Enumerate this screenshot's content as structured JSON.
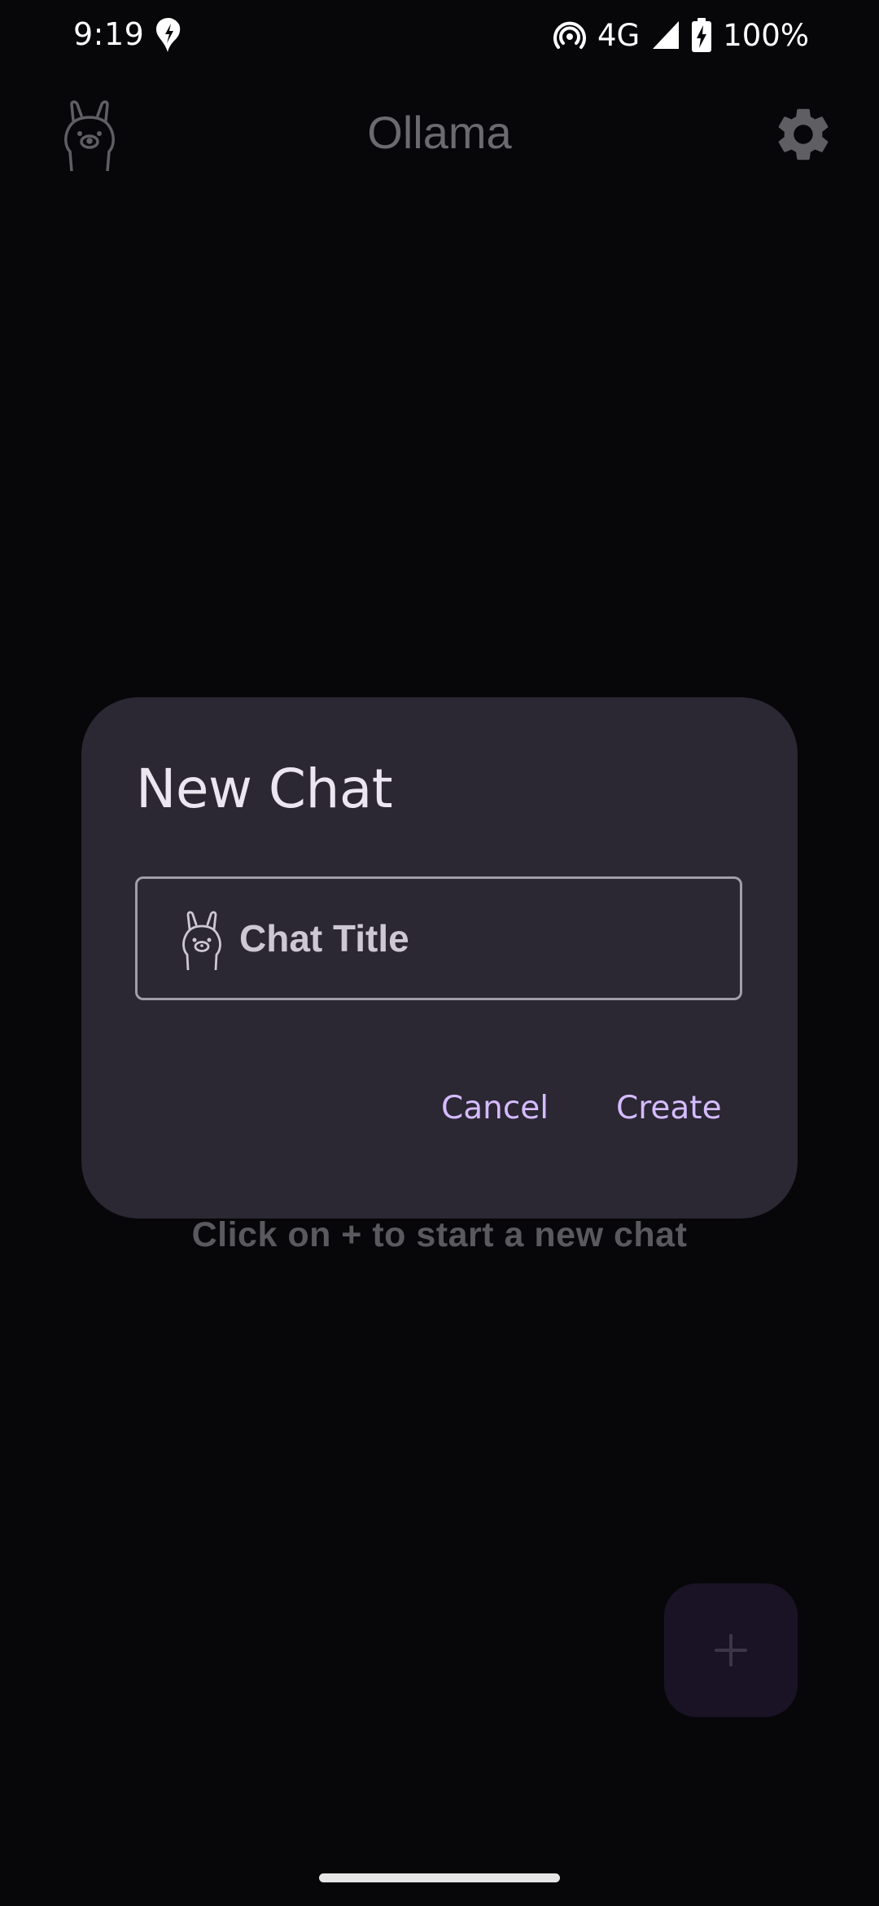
{
  "status_bar": {
    "time": "9:19",
    "network": "4G",
    "battery": "100%",
    "icons": [
      "app-notification-icon",
      "hotspot-icon",
      "cell-signal-icon",
      "battery-charging-icon"
    ]
  },
  "app_bar": {
    "title": "Ollama",
    "logo_icon": "llama-icon",
    "settings_icon": "gear-icon"
  },
  "main": {
    "empty_hint": "Click on + to start a new chat"
  },
  "fab": {
    "icon": "plus-icon",
    "label": "+"
  },
  "dialog": {
    "title": "New Chat",
    "field": {
      "icon": "llama-icon",
      "value": "",
      "placeholder": "Chat Title"
    },
    "cancel_label": "Cancel",
    "create_label": "Create"
  },
  "colors": {
    "background": "#07070a",
    "dialog_surface": "#2b2733",
    "accent": "#d5bbff",
    "fab_container": "#1a1326"
  }
}
